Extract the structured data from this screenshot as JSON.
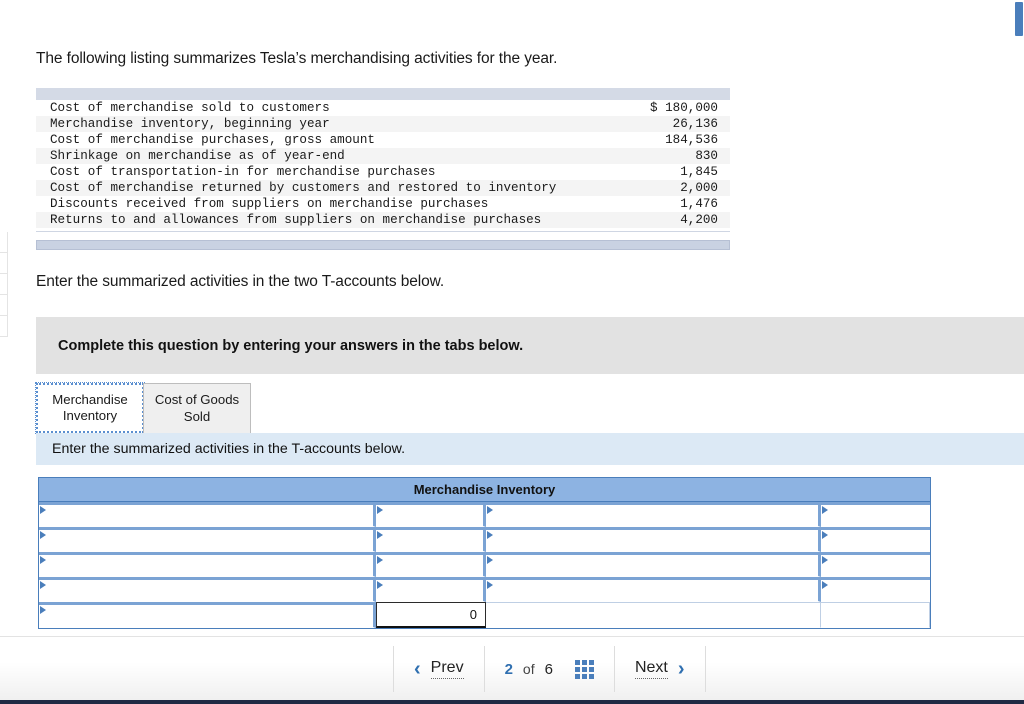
{
  "intro_text": "The following listing summarizes Tesla’s merchandising activities for the year.",
  "listing": {
    "rows": [
      {
        "label": "Cost of merchandise sold to customers",
        "value": "$ 180,000"
      },
      {
        "label": "Merchandise inventory, beginning year",
        "value": "26,136"
      },
      {
        "label": "Cost of merchandise purchases, gross amount",
        "value": "184,536"
      },
      {
        "label": "Shrinkage on merchandise as of year-end",
        "value": "830"
      },
      {
        "label": "Cost of transportation-in for merchandise purchases",
        "value": "1,845"
      },
      {
        "label": "Cost of merchandise returned by customers and restored to inventory",
        "value": "2,000"
      },
      {
        "label": "Discounts received from suppliers on merchandise purchases",
        "value": "1,476"
      },
      {
        "label": "Returns to and allowances from suppliers on merchandise purchases",
        "value": "4,200"
      }
    ]
  },
  "instruction_two_taccounts": "Enter the summarized activities in the two T-accounts below.",
  "banner": {
    "text": "Complete this question by entering your answers in the tabs below."
  },
  "tabs": [
    {
      "label": "Merchandise Inventory",
      "active": true
    },
    {
      "label": "Cost of Goods Sold",
      "active": false
    }
  ],
  "band": {
    "text": "Enter the summarized activities in the T-accounts below."
  },
  "taccount": {
    "title": "Merchandise Inventory",
    "total_value": "0"
  },
  "footer": {
    "prev_label": "Prev",
    "next_label": "Next",
    "page_current": "2",
    "page_of": "of",
    "page_total": "6",
    "grid_icon": "grid-icon"
  },
  "colors": {
    "header_blue": "#8db3e2",
    "band_blue": "#dce9f5",
    "banner_gray": "#e2e2e2",
    "accent_blue": "#4a7ebb"
  }
}
